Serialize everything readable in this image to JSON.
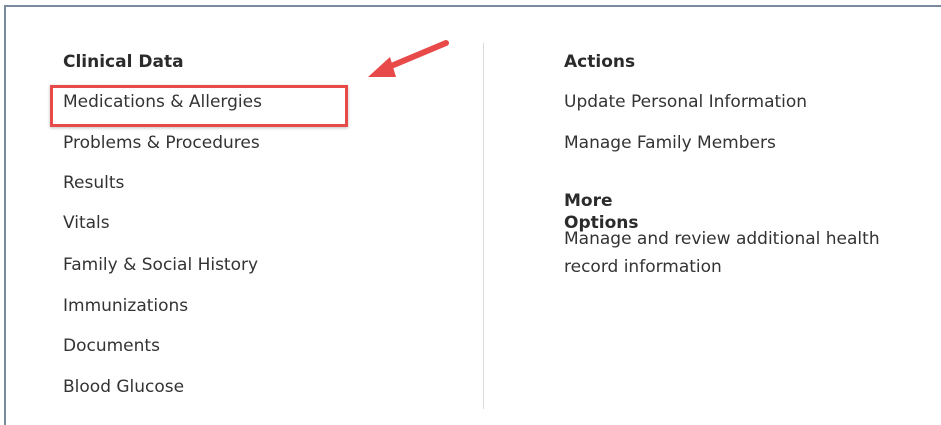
{
  "clinical_data": {
    "heading": "Clinical Data",
    "items": [
      {
        "label": "Medications & Allergies"
      },
      {
        "label": "Problems & Procedures"
      },
      {
        "label": "Results"
      },
      {
        "label": "Vitals"
      },
      {
        "label": "Family & Social History"
      },
      {
        "label": "Immunizations"
      },
      {
        "label": "Documents"
      },
      {
        "label": "Blood Glucose"
      }
    ]
  },
  "actions": {
    "heading": "Actions",
    "items": [
      {
        "label": "Update Personal Information"
      },
      {
        "label": "Manage Family Members"
      }
    ]
  },
  "more_options": {
    "heading": "More Options",
    "description": "Manage and review additional health record information"
  },
  "annotation": {
    "highlight_color": "#e84a4a",
    "arrow_color": "#e84a4a",
    "highlighted_item": "Medications & Allergies",
    "arrow_icon": "red-pointer-arrow"
  },
  "colors": {
    "text": "#333333",
    "heading": "#2b2b2b",
    "frame_border": "#7a8ba0",
    "divider": "#d9d9d9"
  }
}
